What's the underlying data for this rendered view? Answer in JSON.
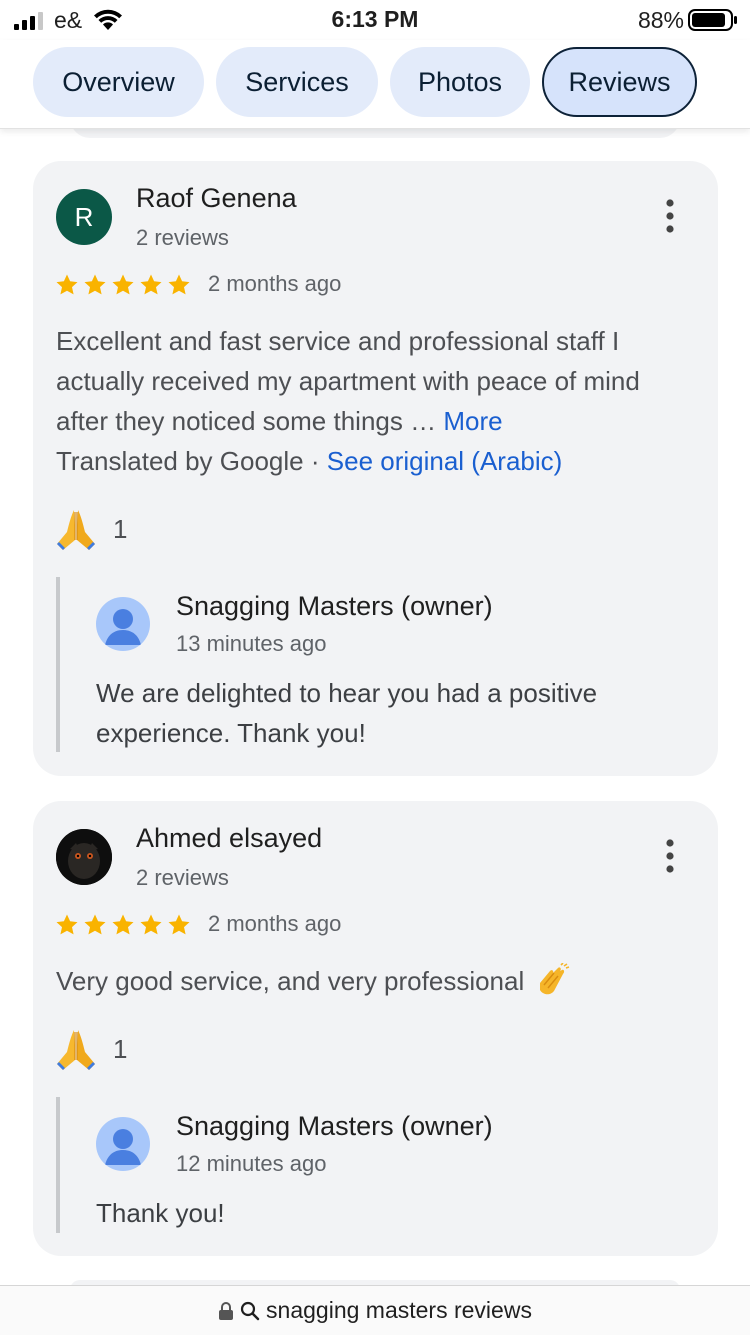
{
  "status_bar": {
    "carrier": "e&",
    "time": "6:13 PM",
    "battery": "88%"
  },
  "tabs": [
    {
      "label": "Overview",
      "active": false
    },
    {
      "label": "Services",
      "active": false
    },
    {
      "label": "Photos",
      "active": false
    },
    {
      "label": "Reviews",
      "active": true
    }
  ],
  "reviews": [
    {
      "avatar_letter": "R",
      "name": "Raof Genena",
      "count": "2 reviews",
      "rating": 5,
      "date": "2 months ago",
      "text": "Excellent and fast service and professional staff I actually received my apartment with peace of mind after they noticed some things …",
      "more_label": "More",
      "translated_label": "Translated by Google",
      "separator": "·",
      "see_original_label": "See original (Arabic)",
      "reaction_count": "1",
      "owner": {
        "name": "Snagging Masters (owner)",
        "time": "13 minutes ago",
        "text": "We are delighted to hear you had a positive experience. Thank you!"
      }
    },
    {
      "name": "Ahmed elsayed",
      "count": "2 reviews",
      "rating": 5,
      "date": "2 months ago",
      "text": "Very good service, and very professional",
      "reaction_count": "1",
      "owner": {
        "name": "Snagging Masters (owner)",
        "time": "12 minutes ago",
        "text": "Thank you!"
      }
    }
  ],
  "url_bar": {
    "text": "snagging masters reviews"
  },
  "colors": {
    "star": "#f9b300",
    "link": "#1a5fd0",
    "card_bg": "#f2f3f5",
    "tab_bg": "#e3ebfa",
    "avatar_r": "#0b5847"
  }
}
